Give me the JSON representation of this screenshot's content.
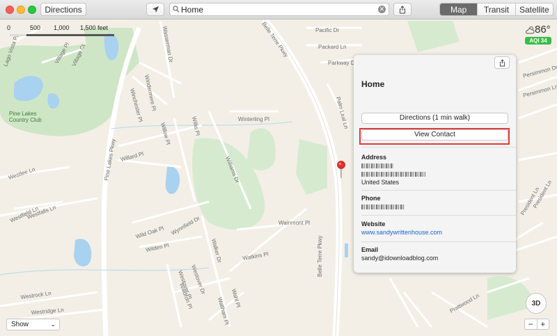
{
  "toolbar": {
    "directions_label": "Directions",
    "search_value": "Home",
    "map_types": [
      "Map",
      "Transit",
      "Satellite"
    ],
    "active_map_type": "Map"
  },
  "scale": {
    "labels": [
      "0",
      "500",
      "1,000",
      "1,500 feet"
    ]
  },
  "weather": {
    "temp": "86°",
    "aqi": "AQI 34"
  },
  "poi": {
    "name_line1": "Pine Lakes",
    "name_line2": "Country Club"
  },
  "roads": {
    "belle_terre_top": "Belle Terre Pkwy",
    "belle_terre_bottom": "Belle Terre Pkwy",
    "pine_lakes": "Pine Lakes Pkwy",
    "pacific": "Pacific Dr",
    "packard": "Packard Ln",
    "parkway": "Parkway Dr",
    "palm_leaf": "Palm Leaf Ln",
    "wasserman": "Wasserman Dr",
    "winchester": "Winchester Pl",
    "windermere": "Windermere Pl",
    "winterling": "Winterling Pl",
    "willis": "Willis Pl",
    "willow": "Willow Pl",
    "willard": "Willard Pl",
    "williams": "Williams Dr",
    "wild_oak": "Wild Oak Pl",
    "wilden": "Wilden Pl",
    "wynnfield": "Wynnfield Dr",
    "walker": "Walker Dr",
    "watkins": "Watkins Pl",
    "wainmont": "Wainmont Pl",
    "westlee": "Westlee Ln",
    "westfield": "Westfield Ln",
    "westfalls": "Westfalls Ln",
    "westrock": "Westrock Ln",
    "westridge": "Westridge Ln",
    "westover": "Westover Dr",
    "westover_pl": "Westover Pl",
    "waldron": "Waldron Pl",
    "wahl": "Wahl Pl",
    "waltham": "Waltham Pl",
    "lago": "Lago Vista Pl",
    "village": "Village Pl",
    "village_ct": "Village Ct",
    "persimmon_dr": "Persimmon Dr",
    "persimmon_ln": "Persimmon Ln",
    "president": "President Ln",
    "president_ln": "President Ln",
    "prattwood": "Prattwood Ln"
  },
  "panel": {
    "title": "Home",
    "directions_button": "Directions (1 min walk)",
    "view_contact_button": "View Contact",
    "address_heading": "Address",
    "address_country": "United States",
    "phone_heading": "Phone",
    "website_heading": "Website",
    "website_value": "www.sandywrittenhouse.com",
    "email_heading": "Email",
    "email_value": "sandy@idownloadblog.com"
  },
  "bottom": {
    "show_label": "Show",
    "compass_label": "3D",
    "zoom_out": "−",
    "zoom_in": "+"
  },
  "colors": {
    "highlight": "#e03a3a",
    "link": "#1a65c8",
    "aqi_badge": "#3dbb4a",
    "park": "#cfe6c6",
    "water": "#a8d2ef"
  }
}
